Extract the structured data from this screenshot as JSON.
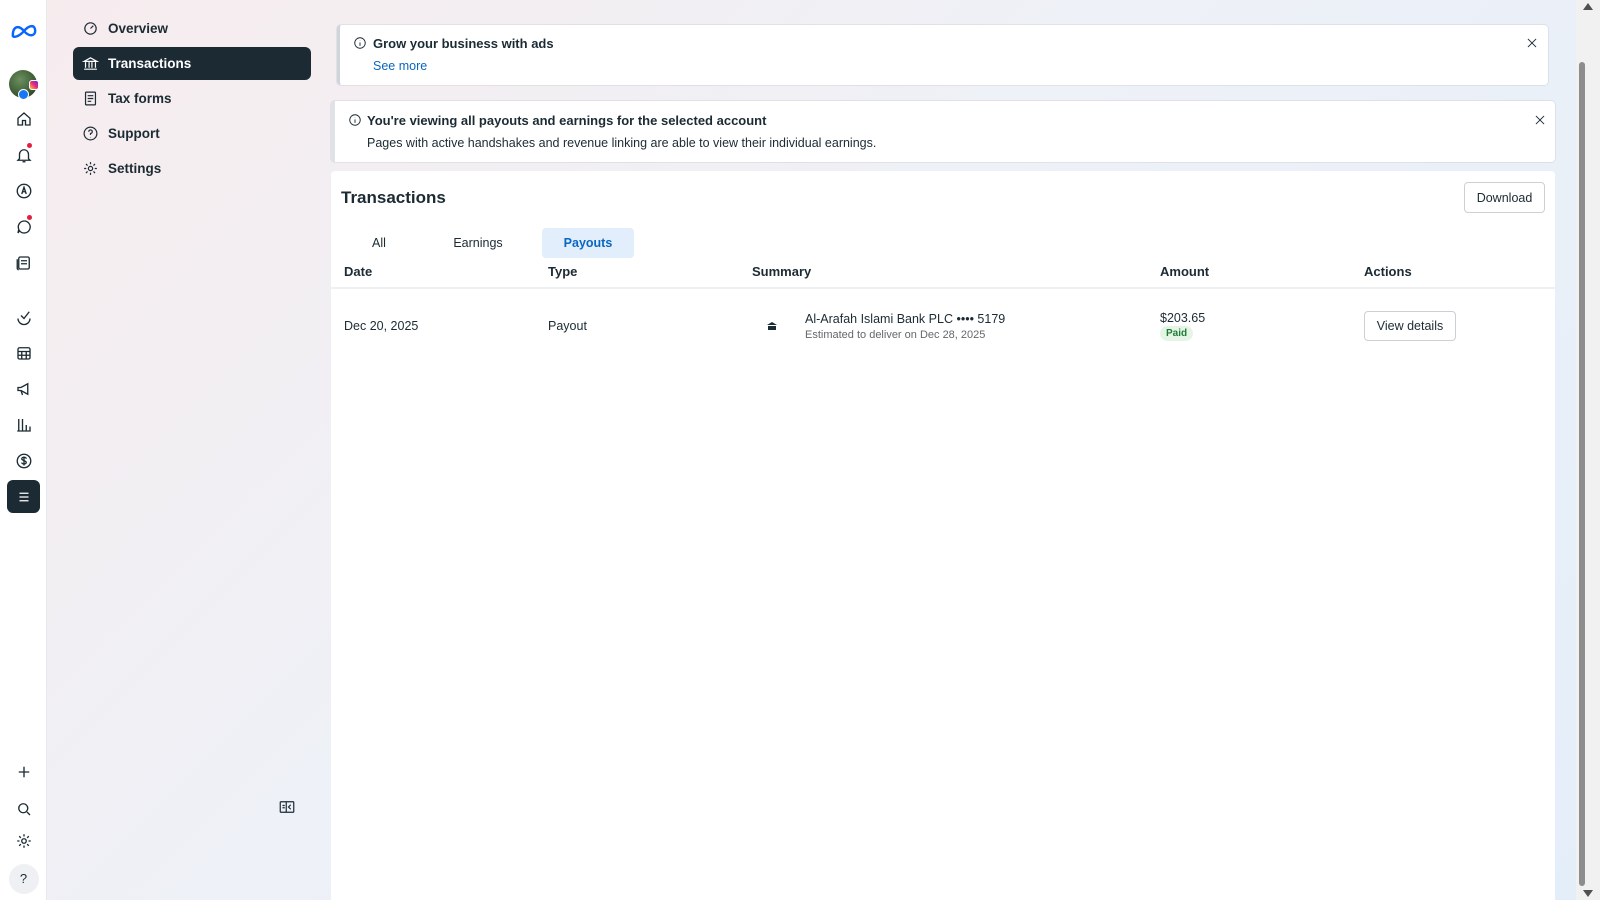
{
  "nav": {
    "items": [
      {
        "label": "Overview",
        "icon": "gauge-icon",
        "active": false
      },
      {
        "label": "Transactions",
        "icon": "bank-icon",
        "active": true
      },
      {
        "label": "Tax forms",
        "icon": "receipt-icon",
        "active": false
      },
      {
        "label": "Support",
        "icon": "help-circle-icon",
        "active": false
      },
      {
        "label": "Settings",
        "icon": "gear-icon",
        "active": false
      }
    ]
  },
  "banners": {
    "ads": {
      "title": "Grow your business with ads",
      "link": "See more"
    },
    "account": {
      "title": "You're viewing all payouts and earnings for the selected account",
      "text": "Pages with active handshakes and revenue linking are able to view their individual earnings."
    }
  },
  "transactions": {
    "title": "Transactions",
    "download_label": "Download",
    "tabs": [
      {
        "label": "All",
        "active": false
      },
      {
        "label": "Earnings",
        "active": false
      },
      {
        "label": "Payouts",
        "active": true
      }
    ],
    "columns": [
      "Date",
      "Type",
      "Summary",
      "Amount",
      "Actions"
    ],
    "rows": [
      {
        "date": "Dec 20, 2025",
        "type": "Payout",
        "summary": "Al-Arafah Islami Bank PLC •••• 5179",
        "summary_sub": "Estimated to deliver on Dec 28, 2025",
        "amount": "$203.65",
        "status": "Paid",
        "action": "View details"
      }
    ]
  },
  "rail": {
    "help_label": "?"
  },
  "colors": {
    "accent": "#0a66c2",
    "dark": "#1c2b33",
    "paid_bg": "#e4f5e6",
    "paid_text": "#1e7c34",
    "notification": "#e41e3f"
  }
}
